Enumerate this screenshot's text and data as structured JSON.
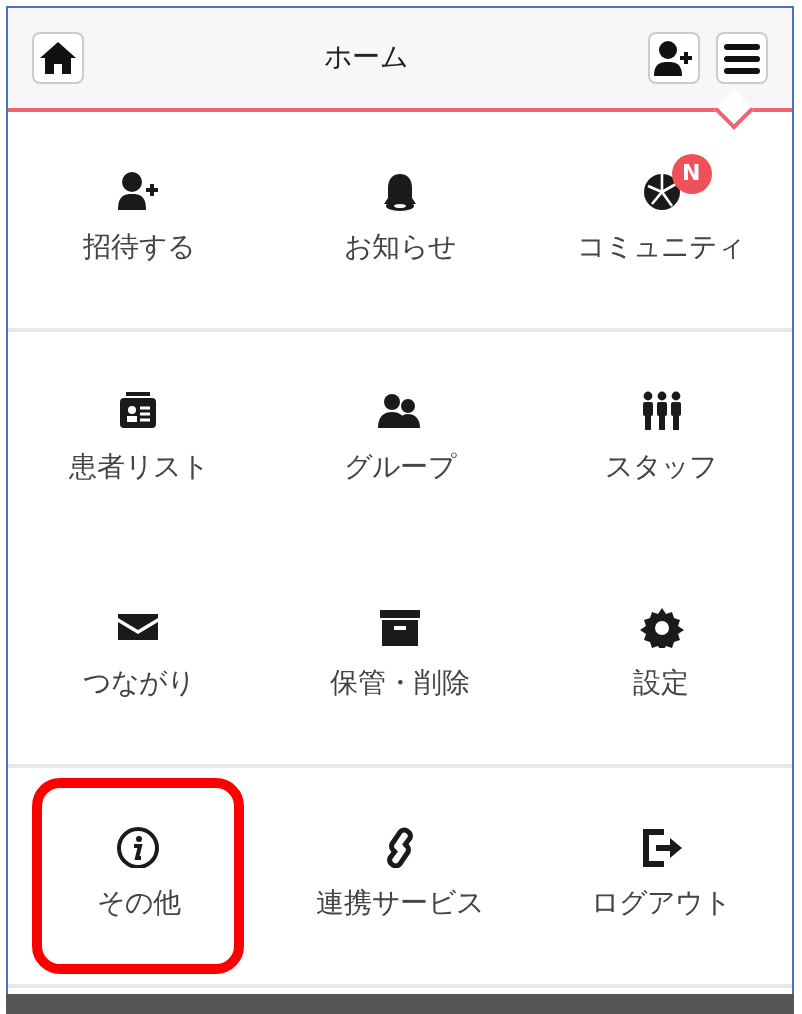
{
  "header": {
    "title": "ホーム"
  },
  "sections": [
    {
      "items": [
        {
          "label": "招待する",
          "highlighted": false
        },
        {
          "label": "お知らせ",
          "highlighted": false
        },
        {
          "label": "コミュニティ",
          "highlighted": false,
          "badge": "N"
        }
      ]
    },
    {
      "items": [
        {
          "label": "患者リスト",
          "highlighted": false
        },
        {
          "label": "グループ",
          "highlighted": false
        },
        {
          "label": "スタッフ",
          "highlighted": false
        },
        {
          "label": "つながり",
          "highlighted": false
        },
        {
          "label": "保管・削除",
          "highlighted": false
        },
        {
          "label": "設定",
          "highlighted": false
        }
      ]
    },
    {
      "items": [
        {
          "label": "その他",
          "highlighted": true
        },
        {
          "label": "連携サービス",
          "highlighted": false
        },
        {
          "label": "ログアウト",
          "highlighted": false
        }
      ]
    }
  ]
}
